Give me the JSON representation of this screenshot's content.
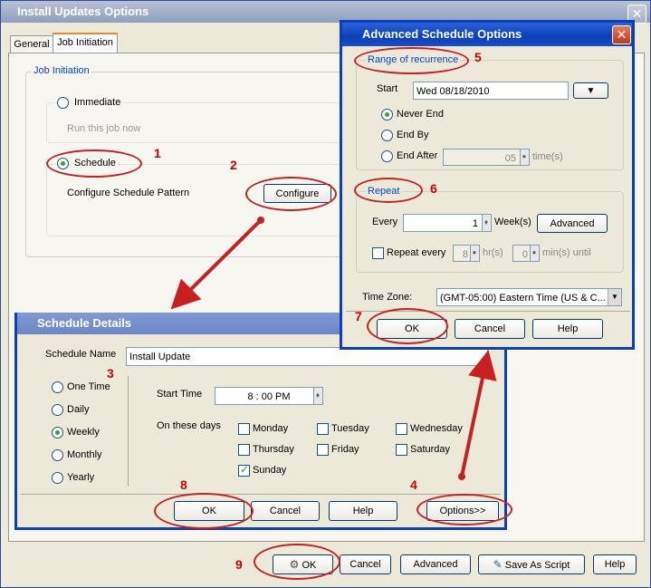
{
  "main": {
    "title": "Install Updates Options",
    "close_glyph": "✕",
    "tabs": [
      {
        "label": "General"
      },
      {
        "label": "Job Initiation"
      }
    ],
    "group_title": "Job Initiation",
    "immediate_label": "Immediate",
    "run_now_label": "Run this job now",
    "schedule_label": "Schedule",
    "configure_pattern_label": "Configure Schedule Pattern",
    "configure_button": "Configure",
    "bottom_buttons": {
      "ok": "OK",
      "cancel": "Cancel",
      "advanced": "Advanced",
      "save_as_script": "Save As Script",
      "help": "Help"
    }
  },
  "schedule_details": {
    "title": "Schedule Details",
    "name_label": "Schedule Name",
    "name_value": "Install Update",
    "frequencies": [
      {
        "label": "One Time",
        "selected": false
      },
      {
        "label": "Daily",
        "selected": false
      },
      {
        "label": "Weekly",
        "selected": true
      },
      {
        "label": "Monthly",
        "selected": false
      },
      {
        "label": "Yearly",
        "selected": false
      }
    ],
    "start_time_label": "Start Time",
    "start_time_value": "8 : 00 PM",
    "days_label": "On these days",
    "days": [
      {
        "label": "Monday",
        "checked": false
      },
      {
        "label": "Tuesday",
        "checked": false
      },
      {
        "label": "Wednesday",
        "checked": false
      },
      {
        "label": "Thursday",
        "checked": false
      },
      {
        "label": "Friday",
        "checked": false
      },
      {
        "label": "Saturday",
        "checked": false
      },
      {
        "label": "Sunday",
        "checked": true
      }
    ],
    "buttons": {
      "ok": "OK",
      "cancel": "Cancel",
      "help": "Help",
      "options": "Options>>"
    }
  },
  "advanced": {
    "title": "Advanced Schedule Options",
    "close_glyph": "✕",
    "range_title": "Range of recurrence",
    "start_label": "Start",
    "start_value": "Wed 08/18/2010",
    "dropdown_glyph": "▼",
    "never_end_label": "Never End",
    "end_by_label": "End By",
    "end_after_label": "End After",
    "end_after_value": "05",
    "times_label": "time(s)",
    "repeat_title": "Repeat",
    "every_label": "Every",
    "every_value": "1",
    "weeks_label": "Week(s)",
    "advanced_button": "Advanced",
    "repeat_every_label": "Repeat every",
    "hr_value": "8",
    "hr_label": "hr(s)",
    "min_value": "0",
    "min_until_label": "min(s) until",
    "timezone_label": "Time Zone:",
    "timezone_value": "(GMT-05:00) Eastern Time (US & C...",
    "buttons": {
      "ok": "OK",
      "cancel": "Cancel",
      "help": "Help"
    }
  },
  "annotations": [
    "1",
    "2",
    "3",
    "4",
    "5",
    "6",
    "7",
    "8",
    "9"
  ],
  "colors": {
    "annotation": "#c82020",
    "title_blue": "#0a3fb8",
    "group_title": "#0046d5"
  }
}
